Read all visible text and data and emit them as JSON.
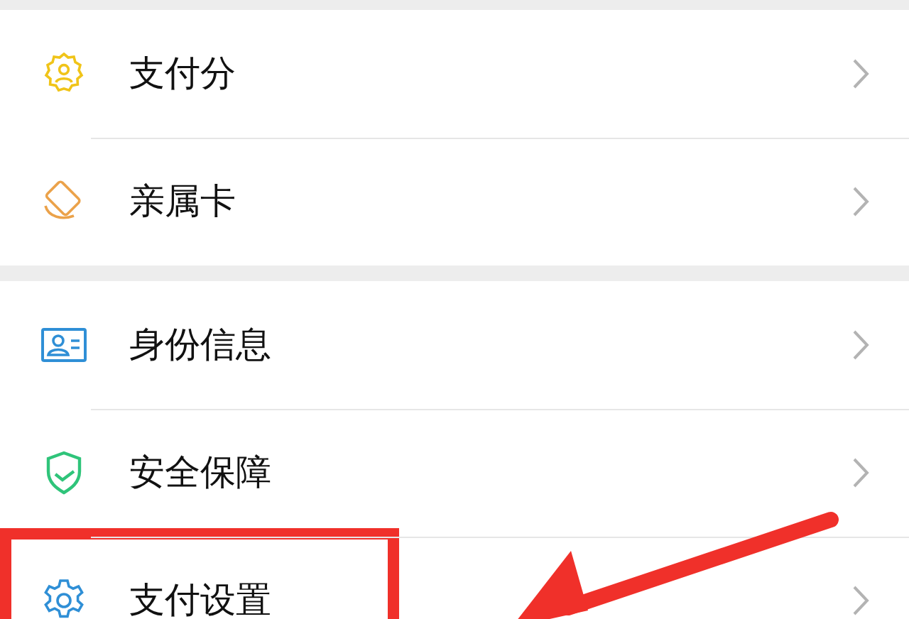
{
  "groups": [
    {
      "items": [
        {
          "label": "支付分",
          "highlighted": false
        },
        {
          "label": "亲属卡",
          "highlighted": false
        }
      ]
    },
    {
      "items": [
        {
          "label": "身份信息",
          "highlighted": false
        },
        {
          "label": "安全保障",
          "highlighted": false
        },
        {
          "label": "支付设置",
          "highlighted": true
        }
      ]
    }
  ]
}
